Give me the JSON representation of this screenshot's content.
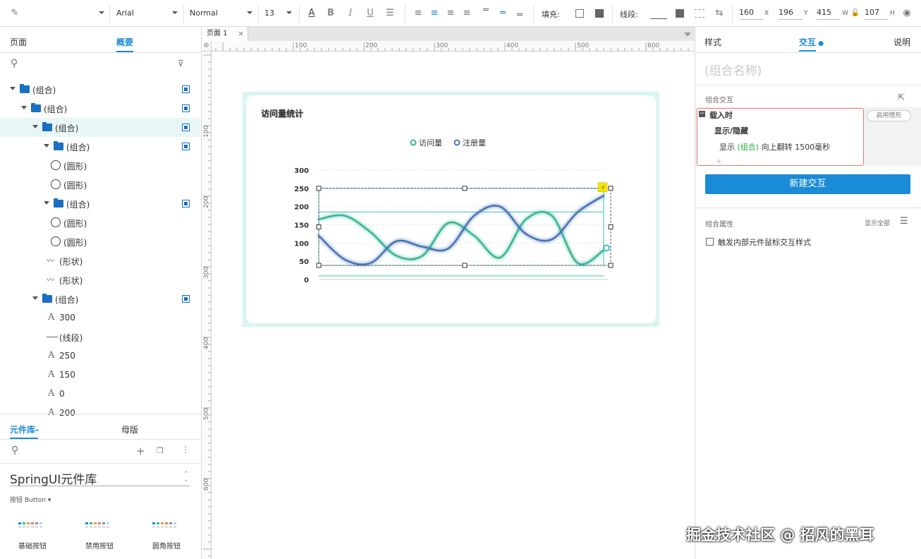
{
  "toolbar": {
    "font_family": "Arial",
    "font_weight": "Normal",
    "font_size": "13",
    "fill_label": "填充:",
    "stroke_label": "线段:",
    "x_value": "160",
    "x_unit": "X",
    "y_value": "196",
    "y_unit": "Y",
    "w_value": "415",
    "w_unit": "W",
    "h_value": "107",
    "h_unit": "H"
  },
  "left_panel": {
    "tabs": [
      "页面",
      "概要"
    ],
    "active_tab": "概要",
    "tree": [
      {
        "label": "(组合)",
        "type": "group",
        "indent": 0
      },
      {
        "label": "(组合)",
        "type": "group",
        "indent": 1
      },
      {
        "label": "(组合)",
        "type": "group",
        "indent": 2,
        "selected": true
      },
      {
        "label": "(组合)",
        "type": "group",
        "indent": 3
      },
      {
        "label": "(圆形)",
        "type": "circle",
        "indent": 4
      },
      {
        "label": "(圆形)",
        "type": "circle",
        "indent": 4
      },
      {
        "label": "(组合)",
        "type": "group",
        "indent": 3
      },
      {
        "label": "(圆形)",
        "type": "circle",
        "indent": 4
      },
      {
        "label": "(圆形)",
        "type": "circle",
        "indent": 4
      },
      {
        "label": "(形状)",
        "type": "shape",
        "indent": 3
      },
      {
        "label": "(形状)",
        "type": "shape",
        "indent": 3
      },
      {
        "label": "(组合)",
        "type": "group",
        "indent": 2
      },
      {
        "label": "300",
        "type": "text",
        "indent": 3
      },
      {
        "label": "(线段)",
        "type": "line",
        "indent": 3
      },
      {
        "label": "250",
        "type": "text",
        "indent": 3
      },
      {
        "label": "150",
        "type": "text",
        "indent": 3
      },
      {
        "label": "0",
        "type": "text",
        "indent": 3
      },
      {
        "label": "200",
        "type": "text",
        "indent": 3
      }
    ],
    "library_tabs": [
      "元件库-",
      "母版"
    ],
    "library_name": "SpringUI元件库",
    "category": "按钮 Button ▾",
    "components": [
      "基础按钮",
      "禁用按钮",
      "圆角按钮"
    ]
  },
  "canvas": {
    "page_tab": "页面 1",
    "ruler_h": [
      "100",
      "200",
      "300",
      "400",
      "500",
      "600"
    ],
    "ruler_v": [
      "100",
      "200",
      "300",
      "400",
      "500",
      "600"
    ],
    "card_title": "访问量统计",
    "legend": [
      "访问量",
      "注册量"
    ],
    "series_colors": [
      "#3ab795",
      "#4a74b8"
    ]
  },
  "chart_data": {
    "type": "line",
    "title": "访问量统计",
    "ylim": [
      0,
      300
    ],
    "yticks": [
      "300",
      "250",
      "200",
      "150",
      "100",
      "50",
      "0"
    ],
    "series": [
      {
        "name": "访问量",
        "values": [
          165,
          175,
          130,
          65,
          65,
          155,
          120,
          60,
          165,
          175,
          45,
          80
        ]
      },
      {
        "name": "注册量",
        "values": [
          120,
          55,
          45,
          105,
          90,
          85,
          175,
          200,
          125,
          110,
          185,
          230
        ]
      }
    ]
  },
  "right_panel": {
    "tabs": [
      "样式",
      "交互",
      "说明"
    ],
    "active_tab": "交互",
    "group_name_placeholder": "(组合名称)",
    "section_interaction": "组合交互",
    "event": "载入时",
    "action": "显示/隐藏",
    "detail_prefix": "显示",
    "detail_target": "(组合)",
    "detail_suffix": "向上翻转 1500毫秒",
    "enable_case": "启用情形",
    "new_interaction": "新建交互",
    "section_props": "组合属性",
    "show_all": "显示全部",
    "checkbox_label": "触发内部元件鼠标交互样式"
  },
  "watermark": "掘金技术社区 @ 招风的黑耳"
}
